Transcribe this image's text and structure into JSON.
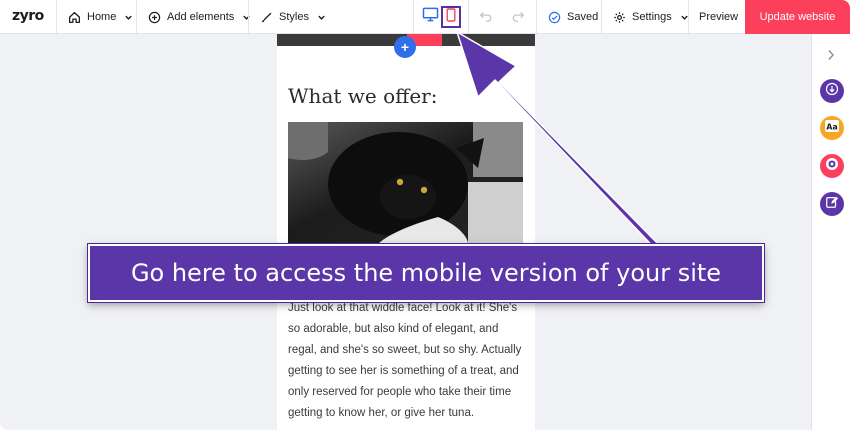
{
  "app": {
    "logo": "zyro"
  },
  "toolbar": {
    "home_label": "Home",
    "add_elements_label": "Add elements",
    "styles_label": "Styles",
    "saved_label": "Saved",
    "settings_label": "Settings",
    "preview_label": "Preview",
    "update_label": "Update website"
  },
  "page": {
    "add_button": "+",
    "section_title": "What we offer:",
    "body_text": "Just look at that widdle face! Look at it! She's so adorable, but also kind of elegant, and regal, and she's so sweet, but so shy. Actually getting to see her is something of a treat, and only reserved for people who take their time getting to know her, or give her tuna."
  },
  "callout": {
    "text": "Go here to access the mobile version of your site"
  },
  "colors": {
    "accent": "#fc3f5a",
    "callout": "#5b36a8",
    "active_device": "#2f6fe8",
    "add_button": "#2f6fe8"
  },
  "icons": {
    "home": "home-icon",
    "add": "plus-circle-icon",
    "styles": "brush-icon",
    "desktop": "desktop-icon",
    "mobile": "mobile-icon",
    "undo": "undo-icon",
    "redo": "redo-icon",
    "saved": "check-circle-icon",
    "settings": "gear-icon",
    "rail": [
      "chevron-right-icon",
      "download-icon",
      "typography-icon",
      "eye-icon",
      "edit-icon"
    ]
  }
}
